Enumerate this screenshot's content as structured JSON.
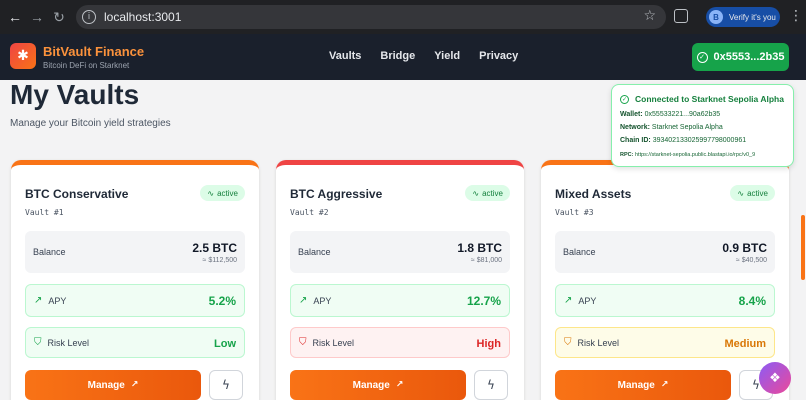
{
  "browser": {
    "url": "localhost:3001",
    "profile_initial": "B",
    "profile_label": "Verify it's you",
    "icons": [
      "back-icon",
      "forward-icon",
      "reload-icon",
      "site-info-icon",
      "bookmark-star-icon",
      "extensions-icon",
      "menu-dots-icon"
    ]
  },
  "header": {
    "brand_title": "BitVault Finance",
    "brand_subtitle": "Bitcoin DeFi on Starknet",
    "nav": [
      "Vaults",
      "Bridge",
      "Yield",
      "Privacy"
    ],
    "wallet_label": "0x5553...2b35"
  },
  "page": {
    "title": "My Vaults",
    "subtitle": "Manage your Bitcoin yield strategies"
  },
  "popover": {
    "title": "Connected to Starknet Sepolia Alpha",
    "wallet_label": "Wallet:",
    "wallet_value": "0x55533221...90a62b35",
    "network_label": "Network:",
    "network_value": "Starknet Sepolia Alpha",
    "chain_label": "Chain ID:",
    "chain_value": "393402133025997798000961",
    "rpc_label": "RPC:",
    "rpc_value": "https://starknet-sepolia.public.blastapi.io/rpc/v0_9"
  },
  "labels": {
    "balance": "Balance",
    "apy": "APY",
    "risk": "Risk Level",
    "manage": "Manage",
    "status": "active"
  },
  "vaults": [
    {
      "name": "BTC Conservative",
      "number": "Vault #1",
      "balance": "2.5 BTC",
      "usd": "≈ $112,500",
      "apy": "5.2%",
      "risk": "Low",
      "top_color": "#f97316"
    },
    {
      "name": "BTC Aggressive",
      "number": "Vault #2",
      "balance": "1.8 BTC",
      "usd": "≈ $81,000",
      "apy": "12.7%",
      "risk": "High",
      "top_color": "#ef4444"
    },
    {
      "name": "Mixed Assets",
      "number": "Vault #3",
      "balance": "0.9 BTC",
      "usd": "≈ $40,500",
      "apy": "8.4%",
      "risk": "Medium",
      "top_color": "#f97316"
    }
  ],
  "risk_colors": {
    "Low": {
      "bg": "#f0fdf4",
      "border": "#bbf7d0",
      "text": "#16a34a"
    },
    "High": {
      "bg": "#fef2f2",
      "border": "#fecaca",
      "text": "#dc2626"
    },
    "Medium": {
      "bg": "#fefce8",
      "border": "#fde68a",
      "text": "#d97706"
    }
  },
  "colors": {
    "brand": "#fb923c",
    "accent": "#f97316",
    "success": "#16a34a"
  }
}
